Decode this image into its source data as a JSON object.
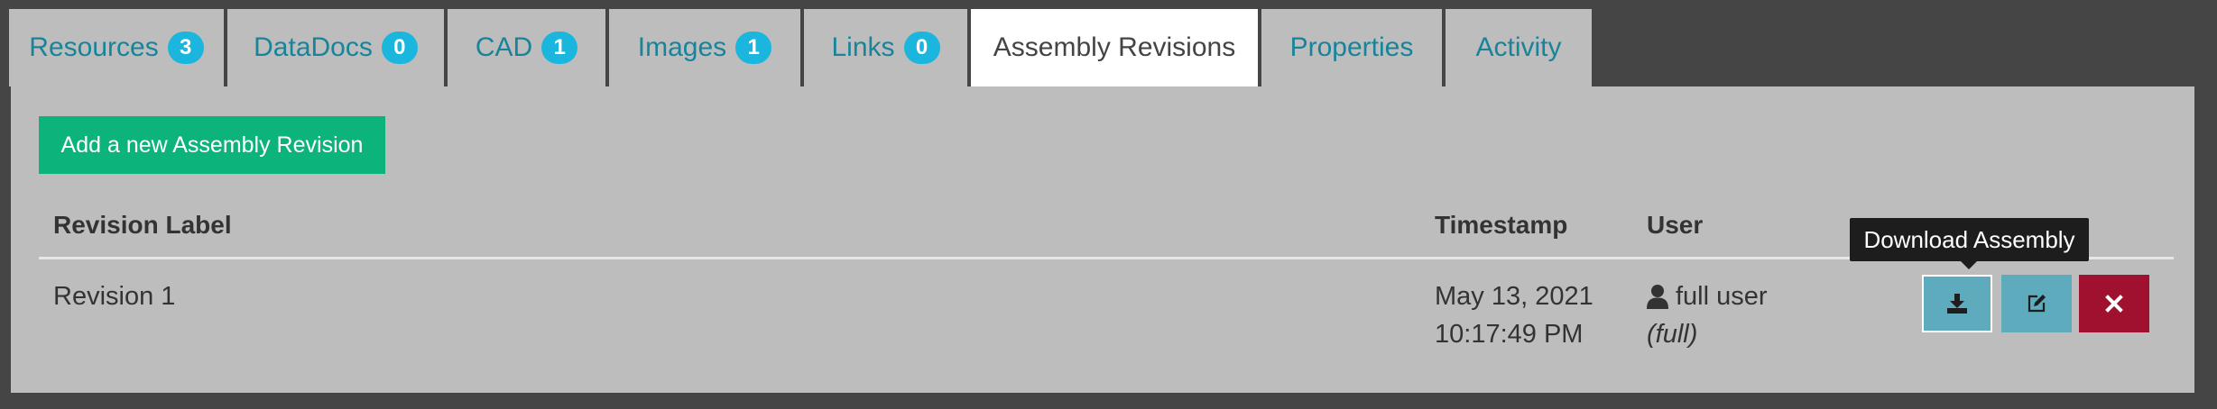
{
  "tabs": [
    {
      "label": "Resources",
      "badge": "3"
    },
    {
      "label": "DataDocs",
      "badge": "0"
    },
    {
      "label": "CAD",
      "badge": "1"
    },
    {
      "label": "Images",
      "badge": "1"
    },
    {
      "label": "Links",
      "badge": "0"
    },
    {
      "label": "Assembly Revisions",
      "active": true
    },
    {
      "label": "Properties"
    },
    {
      "label": "Activity"
    }
  ],
  "add_button": "Add a new Assembly Revision",
  "table": {
    "headers": {
      "revision_label": "Revision Label",
      "timestamp": "Timestamp",
      "user": "User"
    },
    "rows": [
      {
        "revision_label": "Revision 1",
        "timestamp_date": "May 13, 2021",
        "timestamp_time": "10:17:49 PM",
        "user_name": "full user",
        "user_role": "(full)"
      }
    ]
  },
  "actions": {
    "download_icon": "download-icon",
    "edit_icon": "edit-icon",
    "delete_icon": "close-icon"
  },
  "tooltip": "Download Assembly",
  "colors": {
    "accent": "#17849b",
    "badge": "#1bb6de",
    "add_button": "#0cb47c",
    "action_info": "#5dabbd",
    "action_danger": "#a0112f"
  }
}
